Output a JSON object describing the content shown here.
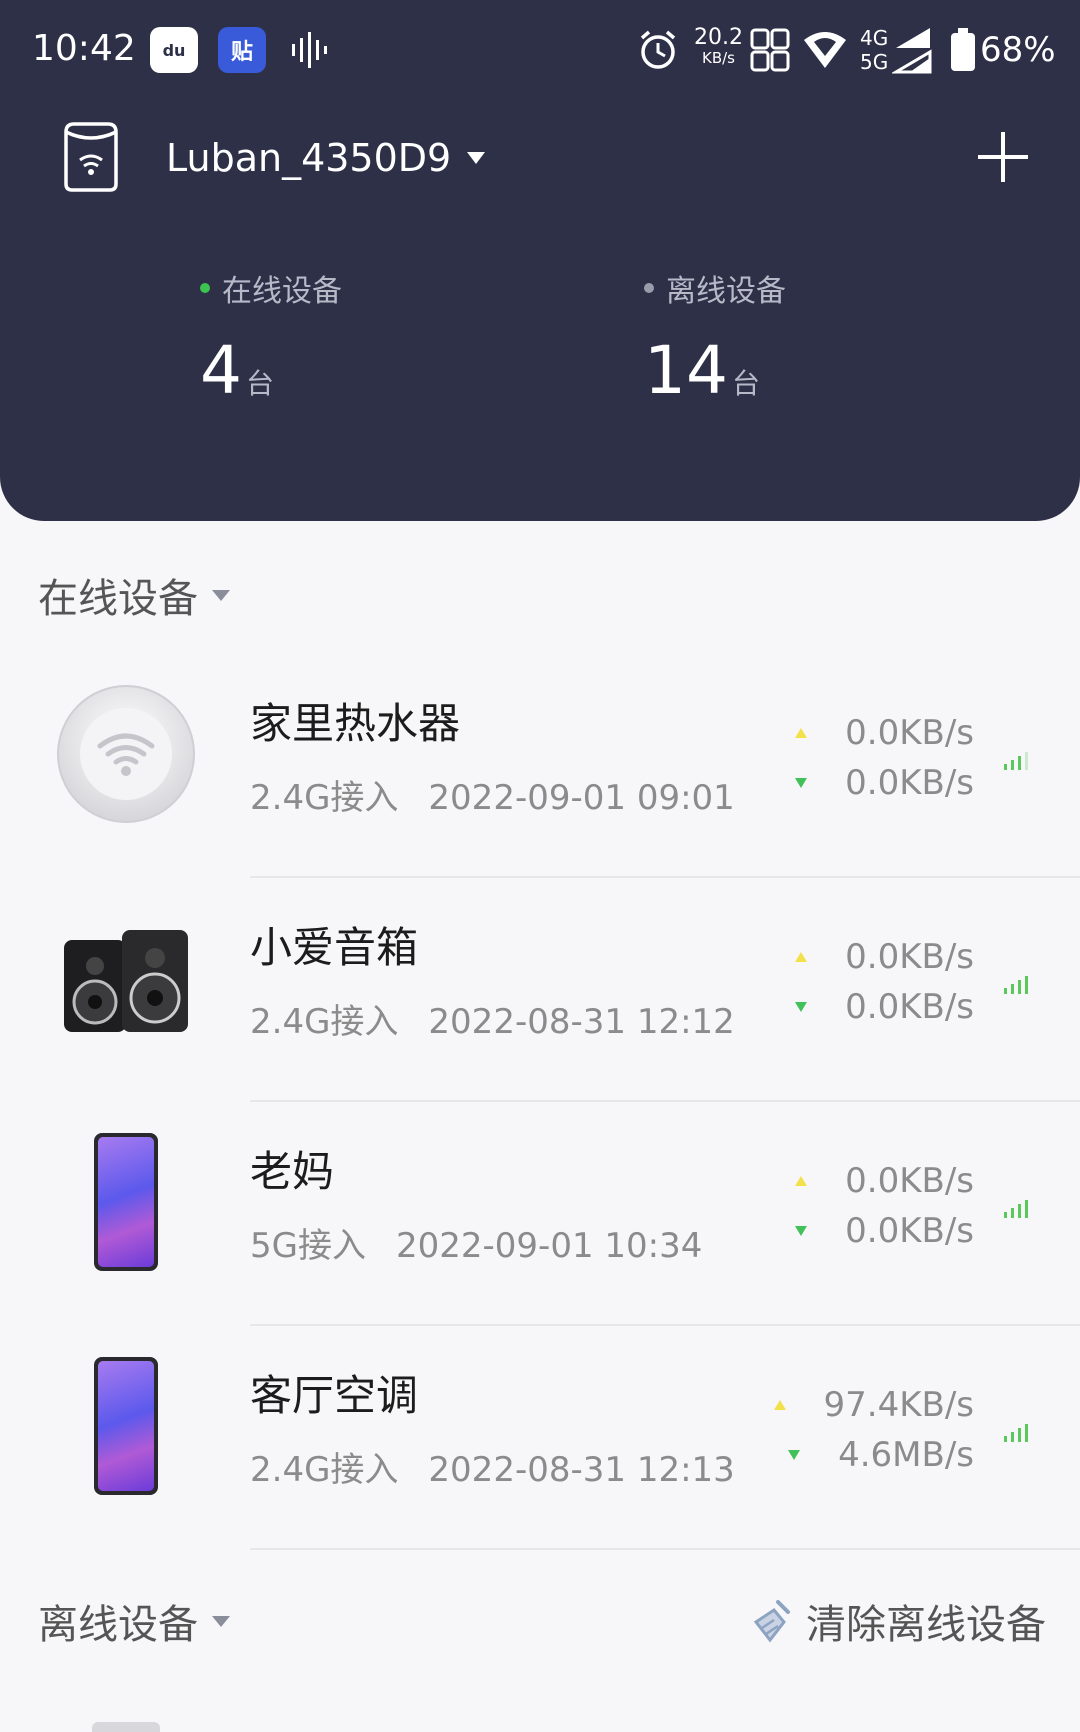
{
  "status_bar": {
    "time": "10:42",
    "app_icon_1": "du",
    "app_icon_2": "贴",
    "net_speed": "20.2",
    "net_speed_unit": "KB/s",
    "network_4g": "4G",
    "network_5g": "5G",
    "battery": "68%"
  },
  "header": {
    "ssid": "Luban_4350D9",
    "online": {
      "label": "在线设备",
      "count": "4",
      "unit": "台",
      "dot_color": "#3cc44f"
    },
    "offline": {
      "label": "离线设备",
      "count": "14",
      "unit": "台",
      "dot_color": "#9a9cab"
    }
  },
  "online_section": {
    "title": "在线设备"
  },
  "offline_section": {
    "title": "离线设备",
    "clear_label": "清除离线设备"
  },
  "devices": [
    {
      "name": "家里热水器",
      "band": "2.4G接入",
      "time": "2022-09-01 09:01",
      "up": "0.0KB/s",
      "down": "0.0KB/s",
      "icon": "wifi-disc-icon"
    },
    {
      "name": "小爱音箱",
      "band": "2.4G接入",
      "time": "2022-08-31 12:12",
      "up": "0.0KB/s",
      "down": "0.0KB/s",
      "icon": "speaker-icon"
    },
    {
      "name": "老妈",
      "band": "5G接入",
      "time": "2022-09-01 10:34",
      "up": "0.0KB/s",
      "down": "0.0KB/s",
      "icon": "phone-icon"
    },
    {
      "name": "客厅空调",
      "band": "2.4G接入",
      "time": "2022-08-31 12:13",
      "up": "97.4KB/s",
      "down": "4.6MB/s",
      "icon": "phone-icon"
    }
  ]
}
